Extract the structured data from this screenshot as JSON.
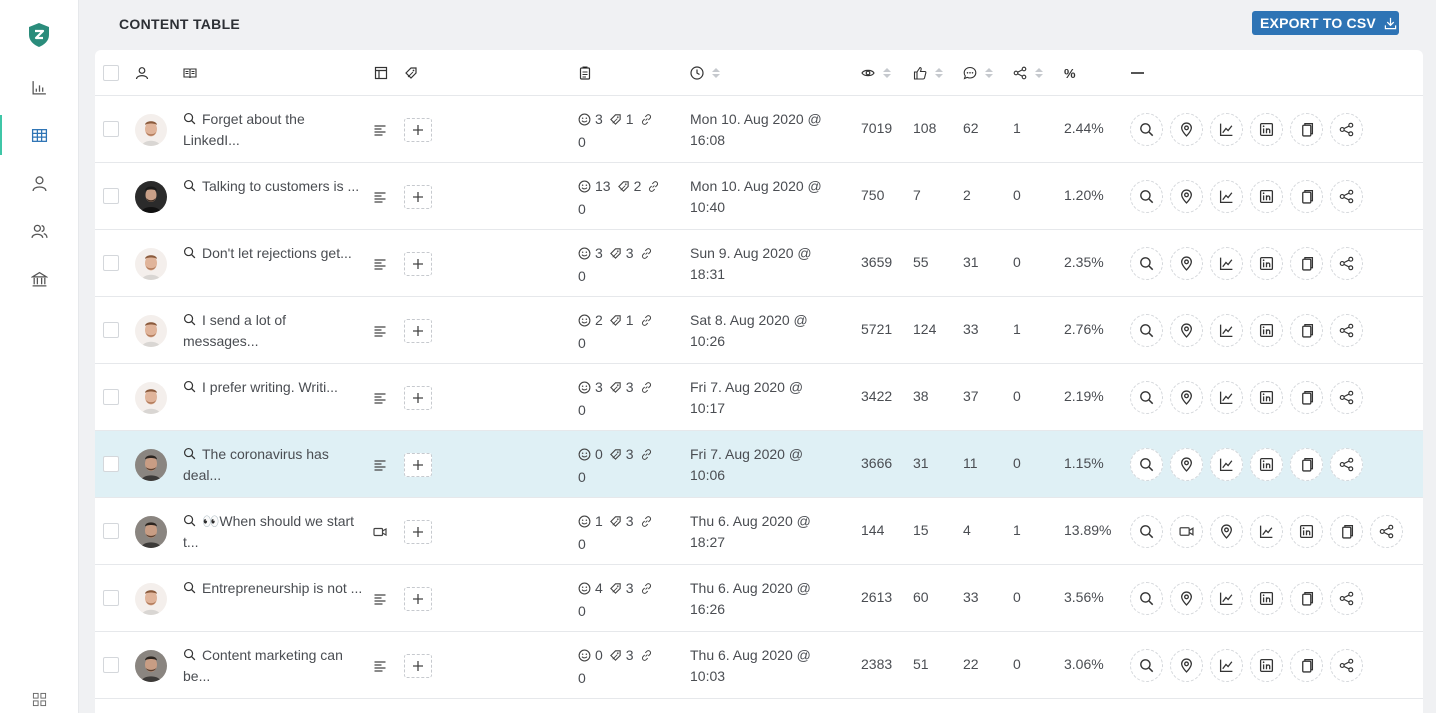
{
  "header": {
    "title": "CONTENT TABLE",
    "export_label": "EXPORT TO CSV"
  },
  "sidebar": {
    "items": [
      {
        "icon": "bar-chart-icon",
        "active": false
      },
      {
        "icon": "table-icon",
        "active": true
      },
      {
        "icon": "user-icon",
        "active": false
      },
      {
        "icon": "users-icon",
        "active": false
      },
      {
        "icon": "bank-icon",
        "active": false
      }
    ]
  },
  "table": {
    "pct_header": "%",
    "rows": [
      {
        "title": "Forget about the LinkedI...",
        "type": "text",
        "comments": "3",
        "tags": "1",
        "links": "0",
        "date": "Mon 10. Aug 2020 @ 16:08",
        "views": "7019",
        "likes": "108",
        "replies": "62",
        "shares": "1",
        "rate": "2.44%",
        "avatar": "a",
        "highlight": false
      },
      {
        "title": "Talking to customers is ...",
        "type": "text",
        "comments": "13",
        "tags": "2",
        "links": "0",
        "date": "Mon 10. Aug 2020 @ 10:40",
        "views": "750",
        "likes": "7",
        "replies": "2",
        "shares": "0",
        "rate": "1.20%",
        "avatar": "b",
        "highlight": false
      },
      {
        "title": "Don't let rejections get...",
        "type": "text",
        "comments": "3",
        "tags": "3",
        "links": "0",
        "date": "Sun 9. Aug 2020 @ 18:31",
        "views": "3659",
        "likes": "55",
        "replies": "31",
        "shares": "0",
        "rate": "2.35%",
        "avatar": "a",
        "highlight": false
      },
      {
        "title": "I send a lot of messages...",
        "type": "text",
        "comments": "2",
        "tags": "1",
        "links": "0",
        "date": "Sat 8. Aug 2020 @ 10:26",
        "views": "5721",
        "likes": "124",
        "replies": "33",
        "shares": "1",
        "rate": "2.76%",
        "avatar": "a",
        "highlight": false
      },
      {
        "title": "I prefer writing. Writi...",
        "type": "text",
        "comments": "3",
        "tags": "3",
        "links": "0",
        "date": "Fri 7. Aug 2020 @ 10:17",
        "views": "3422",
        "likes": "38",
        "replies": "37",
        "shares": "0",
        "rate": "2.19%",
        "avatar": "a",
        "highlight": false
      },
      {
        "title": "The coronavirus has deal...",
        "type": "text",
        "comments": "0",
        "tags": "3",
        "links": "0",
        "date": "Fri 7. Aug 2020 @ 10:06",
        "views": "3666",
        "likes": "31",
        "replies": "11",
        "shares": "0",
        "rate": "1.15%",
        "avatar": "c",
        "highlight": true
      },
      {
        "title": "👀When should we start t...",
        "type": "video",
        "comments": "1",
        "tags": "3",
        "links": "0",
        "date": "Thu 6. Aug 2020 @ 18:27",
        "views": "144",
        "likes": "15",
        "replies": "4",
        "shares": "1",
        "rate": "13.89%",
        "avatar": "c",
        "highlight": false
      },
      {
        "title": "Entrepreneurship is not ...",
        "type": "text",
        "comments": "4",
        "tags": "3",
        "links": "0",
        "date": "Thu 6. Aug 2020 @ 16:26",
        "views": "2613",
        "likes": "60",
        "replies": "33",
        "shares": "0",
        "rate": "3.56%",
        "avatar": "a",
        "highlight": false
      },
      {
        "title": "Content marketing can be...",
        "type": "text",
        "comments": "0",
        "tags": "3",
        "links": "0",
        "date": "Thu 6. Aug 2020 @ 10:03",
        "views": "2383",
        "likes": "51",
        "replies": "22",
        "shares": "0",
        "rate": "3.06%",
        "avatar": "c",
        "highlight": false
      }
    ]
  },
  "colors": {
    "accent": "#3fc6a7",
    "export_button": "#2e74b5",
    "highlight_row": "#dff0f5"
  }
}
